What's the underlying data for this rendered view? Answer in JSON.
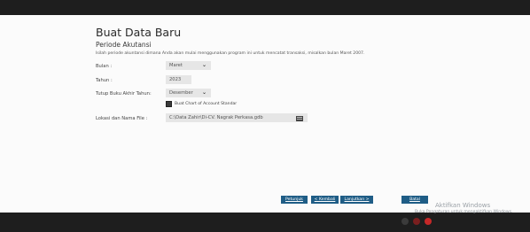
{
  "window": {
    "title": "Buat Data Baru"
  },
  "section": {
    "title": "Periode Akutansi",
    "description": "Isilah periode akuntansi dimana Anda akan mulai menggunakan program ini untuk mencatat transaksi, misalkan bulan Maret 2007."
  },
  "form": {
    "month": {
      "label": "Bulan :",
      "value": "Maret"
    },
    "year": {
      "label": "Tahun :",
      "value": "2023"
    },
    "closing": {
      "label": "Tutup Buku Akhir Tahun:",
      "value": "Desember"
    },
    "chart_of_accounts": {
      "label": "Buat Chart of Account Standar",
      "checked": true
    },
    "file_location": {
      "label": "Lokasi dan Nama File :",
      "value": "C:\\Data Zahir\\Di-CV. Nagrak Perkasa.gdb"
    }
  },
  "buttons": {
    "help": "Petunjuk",
    "back": "< Kembali",
    "next": "Lanjutkan >",
    "cancel": "Batal"
  },
  "watermark": {
    "line1": "Aktifkan Windows",
    "line2": "Buka Pengaturan untuk mengaktifkan Windows."
  },
  "colors": {
    "button": "#1f5d86",
    "bar": "#1e1e1e"
  },
  "icons": {
    "dropdown": "chevron-down-icon",
    "folder": "folder-icon",
    "checkbox": "checkbox-icon"
  }
}
